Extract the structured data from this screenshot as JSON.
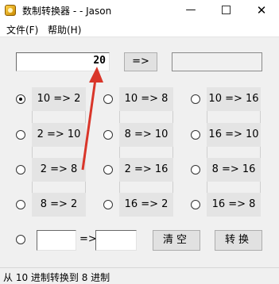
{
  "window": {
    "title": "数制转换器 - - Jason",
    "minimize": "—",
    "close": "✕"
  },
  "menu": [
    {
      "label": "文件(F)"
    },
    {
      "label": "帮助(H)"
    }
  ],
  "input": {
    "value": "20"
  },
  "convert_arrow_button": "=>",
  "output": {
    "value": ""
  },
  "options": [
    {
      "label": "10 => 2",
      "checked": true
    },
    {
      "label": "10 => 8",
      "checked": false
    },
    {
      "label": "10 => 16",
      "checked": false
    },
    {
      "label": "2 => 10",
      "checked": false
    },
    {
      "label": "8 => 10",
      "checked": false
    },
    {
      "label": "16 => 10",
      "checked": false
    },
    {
      "label": "2 => 8",
      "checked": false
    },
    {
      "label": "2 => 16",
      "checked": false
    },
    {
      "label": "8 => 16",
      "checked": false
    },
    {
      "label": "8 => 2",
      "checked": false
    },
    {
      "label": "16 => 2",
      "checked": false
    },
    {
      "label": "16 => 8",
      "checked": false
    }
  ],
  "custom": {
    "from": "",
    "arrow": "=>",
    "to": ""
  },
  "buttons": {
    "clear": "清空",
    "convert": "转换"
  },
  "status": "从 10 进制转换到 8 进制",
  "annotation_color": "#d9362a"
}
